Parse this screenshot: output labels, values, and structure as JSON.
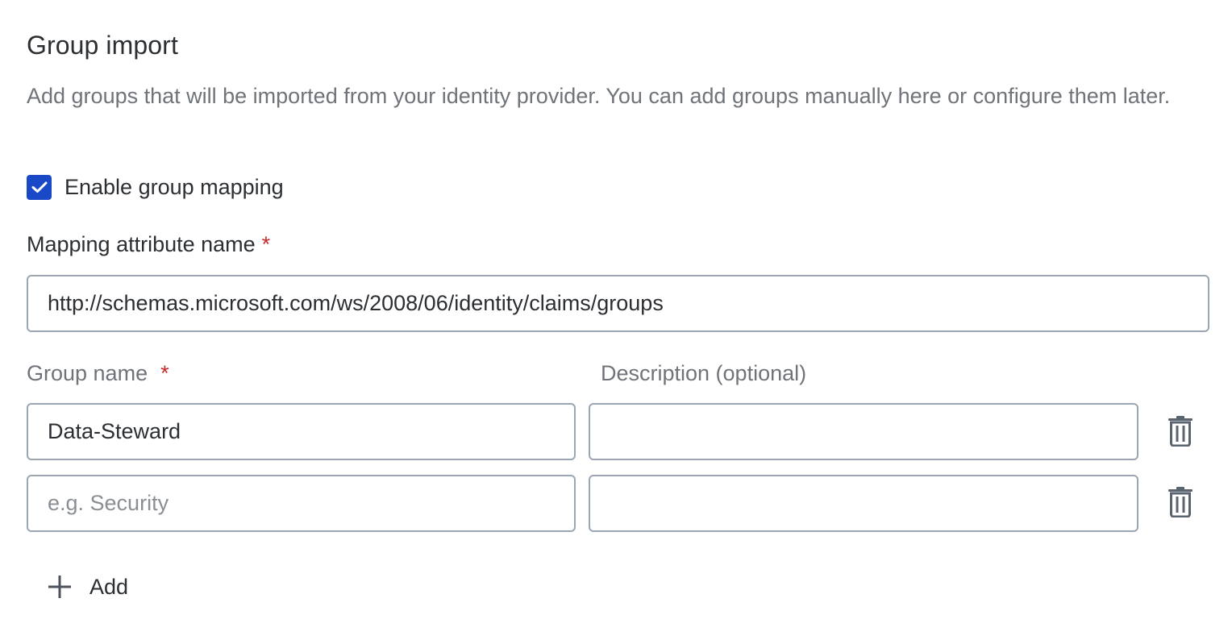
{
  "section": {
    "title": "Group import",
    "description": "Add groups that will be imported from your identity provider. You can add groups manually here or configure them later."
  },
  "group_mapping": {
    "checkbox_label": "Enable group mapping",
    "checked": true
  },
  "mapping_attribute": {
    "label": "Mapping attribute name",
    "required_mark": "*",
    "value": "http://schemas.microsoft.com/ws/2008/06/identity/claims/groups"
  },
  "groups_table": {
    "group_name_header": "Group name",
    "group_name_required_mark": "*",
    "description_header": "Description (optional)",
    "rows": [
      {
        "group_name": "Data-Steward",
        "group_name_placeholder": "",
        "description": ""
      },
      {
        "group_name": "",
        "group_name_placeholder": "e.g. Security",
        "description": ""
      }
    ]
  },
  "add_button": {
    "label": "Add"
  },
  "colors": {
    "accent": "#1a49c8",
    "required": "#c62828",
    "border": "#9aa6b2",
    "text": "#2b2f33",
    "muted_text": "#6f737a"
  },
  "icons": {
    "checkbox": "check-icon",
    "delete": "trash-icon",
    "add": "plus-icon"
  }
}
